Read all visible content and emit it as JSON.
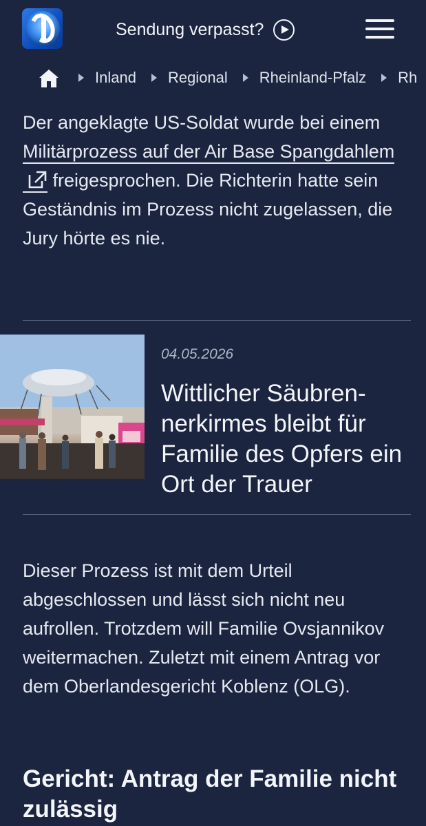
{
  "header": {
    "sendung_label": "Sendung verpasst?",
    "logo_icon": "ard-tagesschau-logo",
    "menu_icon": "hamburger-menu-icon"
  },
  "breadcrumb": {
    "home_icon": "home-icon",
    "items": [
      {
        "label": "Inland"
      },
      {
        "label": "Regional"
      },
      {
        "label": "Rheinland-Pfalz"
      },
      {
        "label": "Rh"
      }
    ]
  },
  "article": {
    "para1_before": "Der angeklagte US-Soldat wurde bei einem ",
    "para1_link": "Militärprozess auf der Air Base Spangdahlem",
    "para1_after": " freigesprochen. Die Richterin hatte sein Geständnis im Prozess nicht zugelassen, die Jury hörte es nie.",
    "teaser": {
      "date": "04.05.2026",
      "title": "Wittlicher Säubren-nerkirmes bleibt für Familie des Opfers ein Ort der Trauer"
    },
    "para2": "Dieser Prozess ist mit dem Urteil abgeschlossen und lässt sich nicht neu aufrollen. Trotzdem will Familie Ovsjannikov weitermachen. Zuletzt mit einem Antrag vor dem Oberlandesgericht Koblenz (OLG).",
    "subheading": "Gericht: Antrag der Familie nicht zulässig"
  },
  "colors": {
    "background": "#1b2540",
    "text": "#e6e9f0",
    "divider": "#56607a",
    "date": "#aeb5c4"
  }
}
